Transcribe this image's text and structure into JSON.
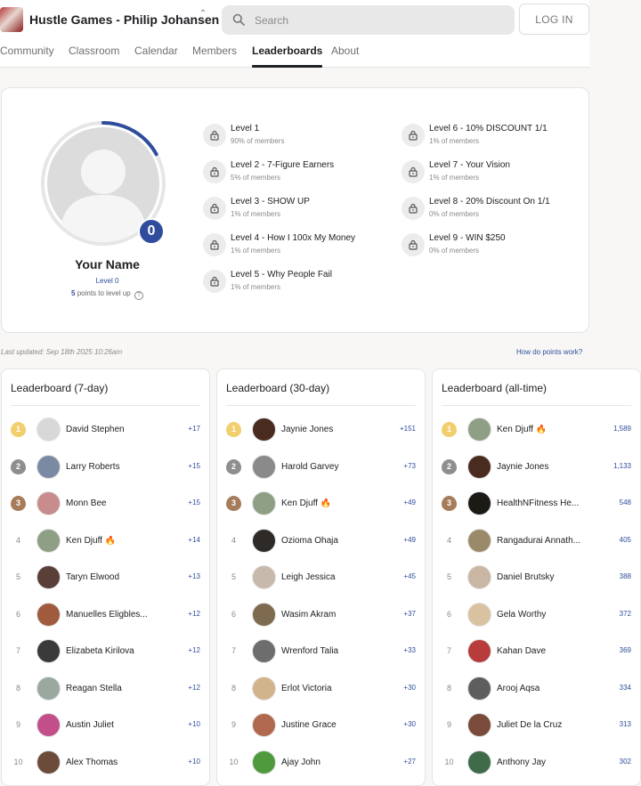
{
  "header": {
    "group_name": "Hustle Games - Philip Johansen",
    "search_placeholder": "Search",
    "login_label": "LOG IN"
  },
  "tabs": [
    {
      "label": "Community"
    },
    {
      "label": "Classroom"
    },
    {
      "label": "Calendar"
    },
    {
      "label": "Members"
    },
    {
      "label": "Leaderboards"
    },
    {
      "label": "About"
    }
  ],
  "active_tab": "Leaderboards",
  "profile": {
    "name": "Your Name",
    "level_label": "Level 0",
    "level_number": "0",
    "points_to_level": "5",
    "points_to_level_text": "points to level up",
    "level_progress": 0.17
  },
  "levels": [
    {
      "name": "Level 1",
      "members": "90% of members"
    },
    {
      "name": "Level 2 - 7-Figure Earners",
      "members": "5% of members"
    },
    {
      "name": "Level 3 - SHOW UP",
      "members": "1% of members"
    },
    {
      "name": "Level 4 - How I 100x My Money",
      "members": "1% of members"
    },
    {
      "name": "Level 5 - Why People Fail",
      "members": "1% of members"
    },
    {
      "name": "Level 6 - 10% DISCOUNT 1/1",
      "members": "1% of members"
    },
    {
      "name": "Level 7 - Your Vision",
      "members": "1% of members"
    },
    {
      "name": "Level 8 - 20% Discount On 1/1",
      "members": "0% of members"
    },
    {
      "name": "Level 9 - WIN $250",
      "members": "0% of members"
    }
  ],
  "last_updated": "Last updated: Sep 18th 2025 10:26am",
  "how_points_link": "How do points work?",
  "leaderboards": [
    {
      "title": "Leaderboard (7-day)",
      "rows": [
        {
          "rank": "1",
          "name": "David Stephen",
          "points": "+17",
          "avatar_color": "#d8d8d8"
        },
        {
          "rank": "2",
          "name": "Larry Roberts",
          "points": "+15",
          "avatar_color": "#7b8aa3"
        },
        {
          "rank": "3",
          "name": "Monn Bee",
          "points": "+15",
          "avatar_color": "#c98c8c"
        },
        {
          "rank": "4",
          "name": "Ken Djuff 🔥",
          "points": "+14",
          "avatar_color": "#8f9f86"
        },
        {
          "rank": "5",
          "name": "Taryn Elwood",
          "points": "+13",
          "avatar_color": "#5a3e38"
        },
        {
          "rank": "6",
          "name": "Manuelles Eligbles...",
          "points": "+12",
          "avatar_color": "#a05a3d"
        },
        {
          "rank": "7",
          "name": "Elizabeta Kirilova",
          "points": "+12",
          "avatar_color": "#3a3a3a"
        },
        {
          "rank": "8",
          "name": "Reagan Stella",
          "points": "+12",
          "avatar_color": "#9aa8a0"
        },
        {
          "rank": "9",
          "name": "Austin Juliet",
          "points": "+10",
          "avatar_color": "#c34f8a"
        },
        {
          "rank": "10",
          "name": "Alex Thomas",
          "points": "+10",
          "avatar_color": "#6b4c3b"
        }
      ]
    },
    {
      "title": "Leaderboard (30-day)",
      "rows": [
        {
          "rank": "1",
          "name": "Jaynie Jones",
          "points": "+151",
          "avatar_color": "#4a2b1f"
        },
        {
          "rank": "2",
          "name": "Harold Garvey",
          "points": "+73",
          "avatar_color": "#8a8a8a"
        },
        {
          "rank": "3",
          "name": "Ken Djuff 🔥",
          "points": "+49",
          "avatar_color": "#8f9f86"
        },
        {
          "rank": "4",
          "name": "Ozioma Ohaja",
          "points": "+49",
          "avatar_color": "#2e2a28"
        },
        {
          "rank": "5",
          "name": "Leigh Jessica",
          "points": "+45",
          "avatar_color": "#c8b9ad"
        },
        {
          "rank": "6",
          "name": "Wasim Akram",
          "points": "+37",
          "avatar_color": "#7e6a4e"
        },
        {
          "rank": "7",
          "name": "Wrenford Talia",
          "points": "+33",
          "avatar_color": "#6d6d6d"
        },
        {
          "rank": "8",
          "name": "Erlot Victoria",
          "points": "+30",
          "avatar_color": "#d2b48c"
        },
        {
          "rank": "9",
          "name": "Justine Grace",
          "points": "+30",
          "avatar_color": "#b0694e"
        },
        {
          "rank": "10",
          "name": "Ajay John",
          "points": "+27",
          "avatar_color": "#4f9a3c"
        }
      ]
    },
    {
      "title": "Leaderboard (all-time)",
      "rows": [
        {
          "rank": "1",
          "name": "Ken Djuff 🔥",
          "points": "1,589",
          "avatar_color": "#8f9f86"
        },
        {
          "rank": "2",
          "name": "Jaynie Jones",
          "points": "1,133",
          "avatar_color": "#4a2b1f"
        },
        {
          "rank": "3",
          "name": "HealthNFitness He...",
          "points": "548",
          "avatar_color": "#1b1a14"
        },
        {
          "rank": "4",
          "name": "Rangadurai Annath...",
          "points": "405",
          "avatar_color": "#9a8a6a"
        },
        {
          "rank": "5",
          "name": "Daniel Brutsky",
          "points": "388",
          "avatar_color": "#c9b6a3"
        },
        {
          "rank": "6",
          "name": "Gela Worthy",
          "points": "372",
          "avatar_color": "#d9c2a0"
        },
        {
          "rank": "7",
          "name": "Kahan Dave",
          "points": "369",
          "avatar_color": "#b83c3c"
        },
        {
          "rank": "8",
          "name": "Arooj Aqsa",
          "points": "334",
          "avatar_color": "#5e5e5e"
        },
        {
          "rank": "9",
          "name": "Juliet De la Cruz",
          "points": "313",
          "avatar_color": "#7a4a3a"
        },
        {
          "rank": "10",
          "name": "Anthony Jay",
          "points": "302",
          "avatar_color": "#3f6b4a"
        }
      ]
    }
  ]
}
